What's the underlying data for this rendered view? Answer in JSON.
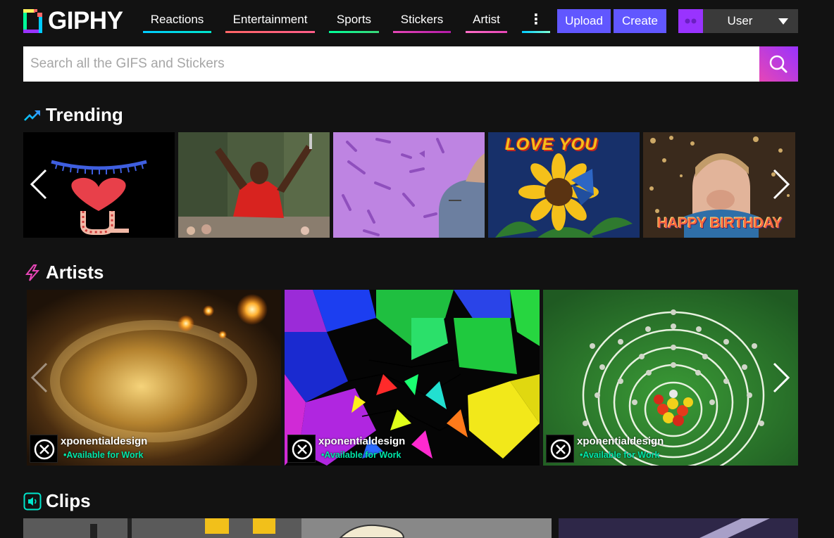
{
  "brand": {
    "name": "GIPHY"
  },
  "nav": {
    "items": [
      {
        "label": "Reactions",
        "color": "#00ccff"
      },
      {
        "label": "Entertainment",
        "color": "#ff6666"
      },
      {
        "label": "Sports",
        "color": "#00ff99"
      },
      {
        "label": "Stickers",
        "color": "#e646b6"
      },
      {
        "label": "Artist",
        "color": "#ff6ec7"
      }
    ],
    "more_label": "⋮",
    "more_color": "#00ccff"
  },
  "actions": {
    "upload_label": "Upload",
    "create_label": "Create"
  },
  "user": {
    "name": "User"
  },
  "search": {
    "placeholder": "Search all the GIFS and Stickers"
  },
  "sections": {
    "trending": {
      "title": "Trending",
      "icon": "trending-icon"
    },
    "artists": {
      "title": "Artists",
      "icon": "lightning-icon"
    },
    "clips": {
      "title": "Clips",
      "icon": "sound-icon"
    }
  },
  "trending_tiles": [
    {
      "name": "heart-u-gif"
    },
    {
      "name": "golfer-celebration-gif"
    },
    {
      "name": "purple-confetti-gif",
      "caption": ""
    },
    {
      "name": "love-you-sunflower-gif",
      "caption": "LOVE YOU"
    },
    {
      "name": "happy-birthday-gif",
      "caption": "HAPPY BIRTHDAY"
    }
  ],
  "artists": [
    {
      "name": "xponentialdesign",
      "status": "•Available for Work"
    },
    {
      "name": "xponentialdesign",
      "status": "•Available for Work"
    },
    {
      "name": "xponentialdesign",
      "status": "•Available for Work"
    }
  ],
  "colors": {
    "background": "#121212",
    "accent": "#6157ff",
    "status_green": "#00e6a8"
  }
}
